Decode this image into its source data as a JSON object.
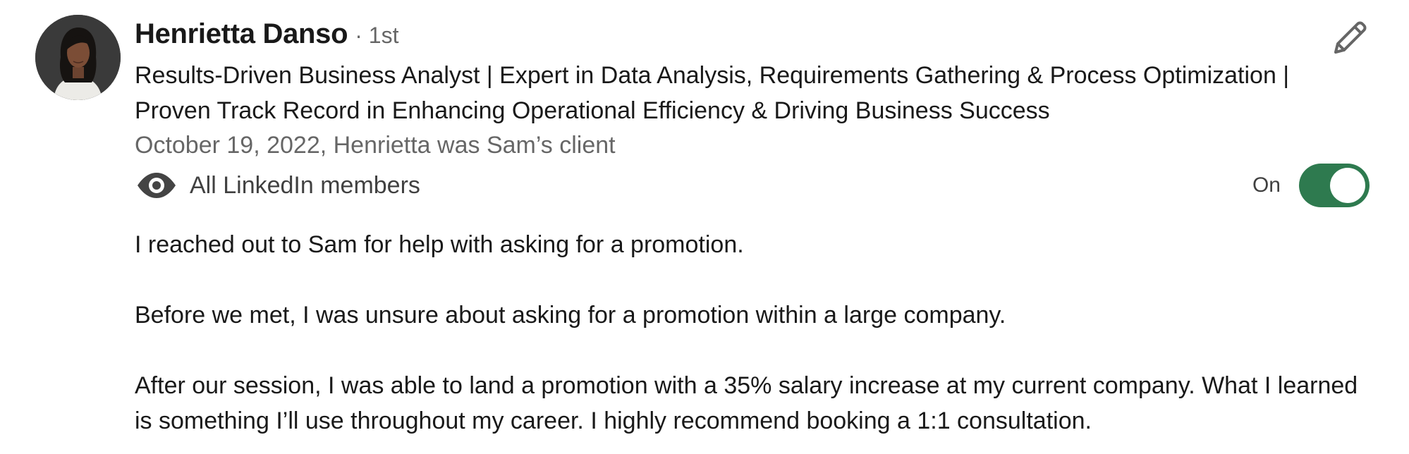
{
  "recommendation": {
    "author_name": "Henrietta Danso",
    "connection_degree": "· 1st",
    "headline": "Results-Driven Business Analyst | Expert in Data Analysis, Requirements Gathering & Process Optimization | Proven Track Record in Enhancing Operational Efficiency & Driving Business Success",
    "meta": "October 19, 2022, Henrietta was Sam’s client",
    "visibility_label": "All LinkedIn members",
    "visibility_icon": "eye-icon",
    "edit_icon": "pencil-icon",
    "toggle": {
      "label": "On",
      "state": true,
      "color": "#2e7a4f"
    },
    "paragraphs": [
      "I reached out to Sam for help with asking for a promotion.",
      "Before we met, I was unsure about asking for a promotion within a large company.",
      "After our session, I was able to land a promotion with a 35% salary increase at my current company. What I learned is something I’ll use throughout my career. I highly recommend booking a 1:1 consultation."
    ]
  }
}
